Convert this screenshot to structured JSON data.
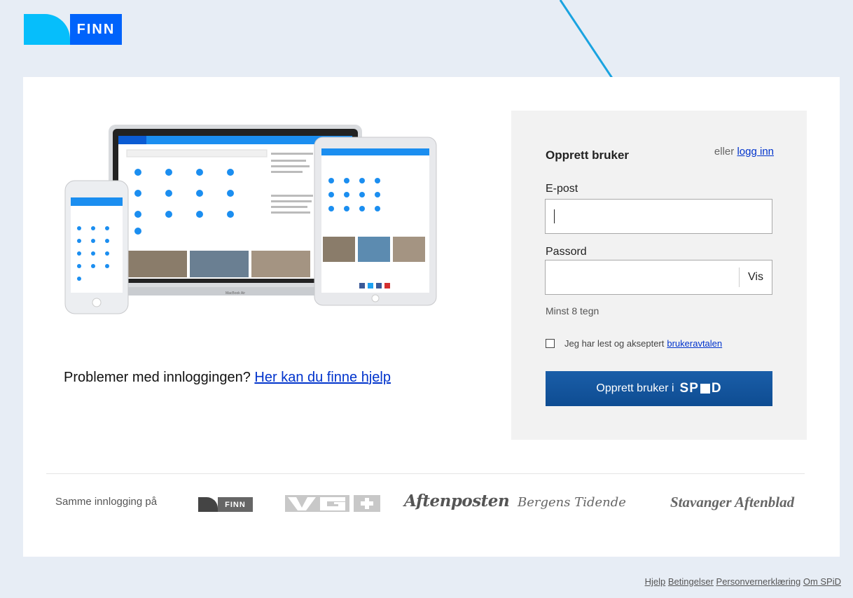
{
  "header": {
    "logo_text": "FINN"
  },
  "colors": {
    "finn_blue": "#0063fb",
    "finn_cyan": "#06befb",
    "button_blue": "#0e4c92",
    "link_blue": "#0033cc",
    "page_bg": "#e7edf5"
  },
  "illustration": {
    "laptop_label": "MacBook Air"
  },
  "help": {
    "text": "Problemer med innloggingen?",
    "link": "Her kan du finne hjelp"
  },
  "form": {
    "title": "Opprett bruker",
    "alt_prefix": "eller",
    "alt_link": "logg inn",
    "email_label": "E-post",
    "email_value": "",
    "password_label": "Passord",
    "password_value": "",
    "show_password": "Vis",
    "password_hint": "Minst 8 tegn",
    "terms_checked": false,
    "terms_text": "Jeg har lest og akseptert",
    "terms_link": "brukeravtalen",
    "submit_label": "Opprett bruker i",
    "submit_brand_a": "SP",
    "submit_brand_b": "D"
  },
  "brands": {
    "intro": "Samme innlogging på",
    "finn": "FINN",
    "vg": "VG+",
    "aftenposten": "Aftenposten",
    "bergens_tidende": "Bergens Tidende",
    "stavanger_aftenblad": "Stavanger Aftenblad"
  },
  "footer": {
    "links": [
      "Hjelp",
      "Betingelser",
      "Personvernerklæring",
      "Om SPiD"
    ]
  }
}
